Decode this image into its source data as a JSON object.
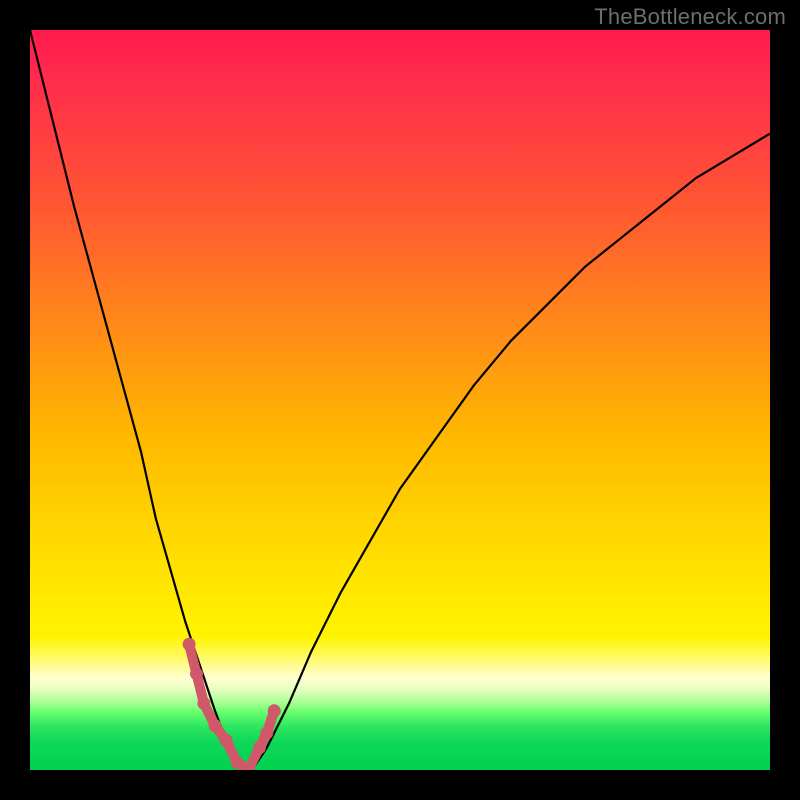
{
  "watermark": "TheBottleneck.com",
  "chart_data": {
    "type": "line",
    "title": "",
    "xlabel": "",
    "ylabel": "",
    "xlim": [
      0,
      100
    ],
    "ylim": [
      0,
      100
    ],
    "background_gradient": {
      "orientation": "vertical",
      "stops": [
        {
          "pos": 0.0,
          "color": "#ff1a4d"
        },
        {
          "pos": 0.5,
          "color": "#ffb800"
        },
        {
          "pos": 0.82,
          "color": "#fff400"
        },
        {
          "pos": 0.88,
          "color": "#ffffd0"
        },
        {
          "pos": 0.92,
          "color": "#70ff70"
        },
        {
          "pos": 1.0,
          "color": "#00d050"
        }
      ]
    },
    "curve_color": "#000000",
    "marker_color": "#d05868",
    "x": [
      0,
      3,
      6,
      9,
      12,
      15,
      17,
      19,
      21,
      23,
      25,
      26.5,
      28,
      30,
      32,
      35,
      38,
      42,
      46,
      50,
      55,
      60,
      65,
      70,
      75,
      80,
      85,
      90,
      95,
      100
    ],
    "y": [
      100,
      88,
      76,
      65,
      54,
      43,
      34,
      27,
      20,
      14,
      8,
      4,
      1,
      0,
      3,
      9,
      16,
      24,
      31,
      38,
      45,
      52,
      58,
      63,
      68,
      72,
      76,
      80,
      83,
      86
    ],
    "marker_points_x": [
      21.5,
      22.5,
      23.5,
      25.0,
      26.5,
      28.0,
      29.5,
      31.0,
      32.0,
      33.0
    ],
    "marker_points_y": [
      17,
      13,
      9,
      6,
      4,
      1,
      0,
      3,
      5,
      8
    ],
    "annotations": []
  }
}
